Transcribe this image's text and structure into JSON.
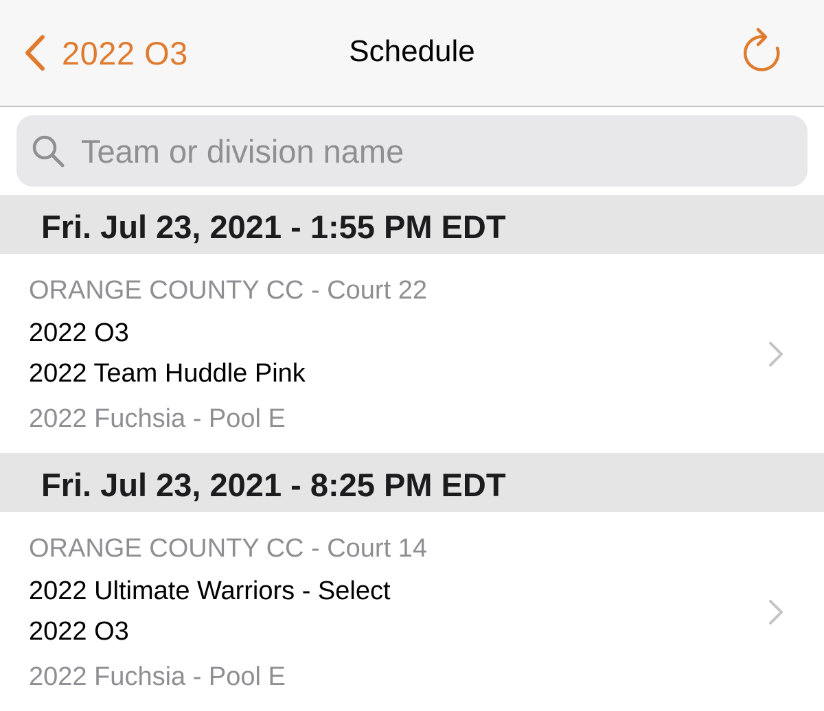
{
  "nav": {
    "back_label": "2022 O3",
    "title": "Schedule",
    "accent_color": "#e07a2f",
    "back_icon": "chevron-left-icon",
    "refresh_icon": "refresh-icon"
  },
  "search": {
    "placeholder": "Team or division name",
    "value": "",
    "icon": "search-icon"
  },
  "sections": [
    {
      "header": "Fri. Jul 23, 2021 - 1:55 PM EDT",
      "game": {
        "location": "ORANGE COUNTY CC - Court 22",
        "team1": "2022 O3",
        "team2": "2022 Team Huddle Pink",
        "division": "2022 Fuchsia - Pool E"
      }
    },
    {
      "header": "Fri. Jul 23, 2021 - 8:25 PM EDT",
      "game": {
        "location": "ORANGE COUNTY CC - Court 14",
        "team1": "2022 Ultimate Warriors - Select",
        "team2": "2022 O3",
        "division": "2022 Fuchsia - Pool E"
      }
    }
  ]
}
